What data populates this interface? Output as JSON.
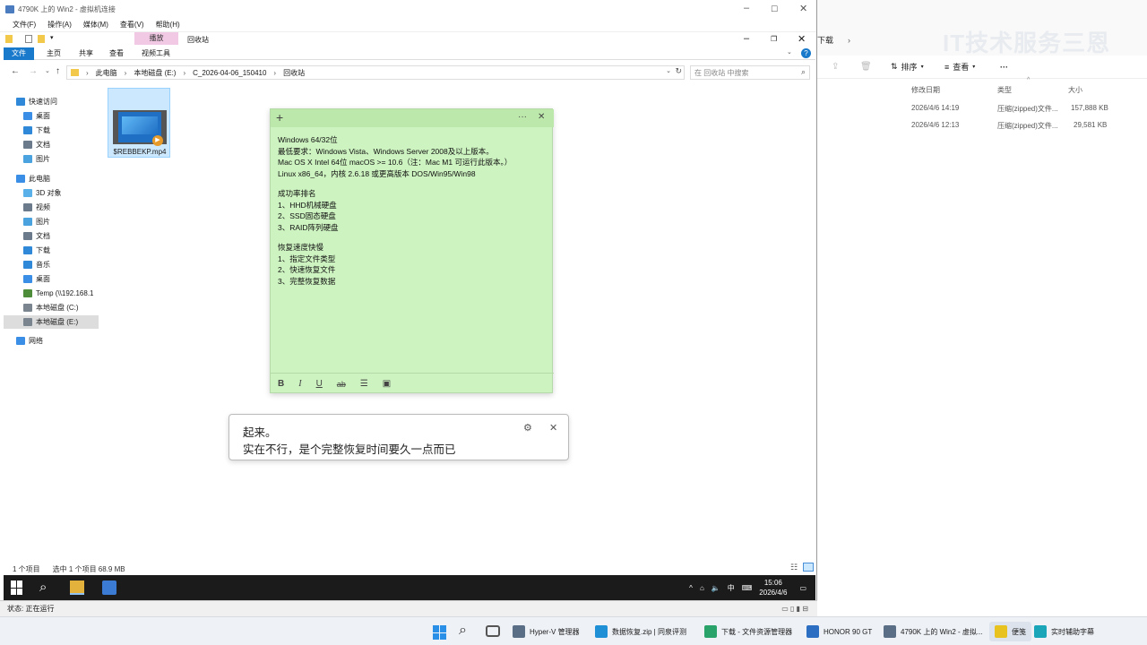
{
  "host": {
    "breadcrumb": "下载",
    "watermark": "IT技术服务三恩",
    "toolbar": {
      "sort": "排序",
      "view": "查看",
      "more": "···"
    },
    "columns": {
      "date": "修改日期",
      "type": "类型",
      "size": "大小"
    },
    "rows": [
      {
        "date": "2026/4/6 14:19",
        "type": "压缩(zipped)文件...",
        "size": "157,888 KB"
      },
      {
        "date": "2026/4/6 12:13",
        "type": "压缩(zipped)文件...",
        "size": "29,581 KB"
      }
    ]
  },
  "vm": {
    "title": "4790K 上的 Win2 - 虚拟机连接",
    "menu": [
      "文件(F)",
      "操作(A)",
      "媒体(M)",
      "查看(V)",
      "帮助(H)"
    ],
    "status": "状态: 正在运行"
  },
  "guest": {
    "ribbon": {
      "context_tab": "播放",
      "window_title": "回收站",
      "tabs": [
        "文件",
        "主页",
        "共享",
        "查看",
        "视频工具"
      ]
    },
    "address": {
      "path": [
        "此电脑",
        "本地磁盘 (E:)",
        "C_2026-04-06_150410",
        "回收站"
      ],
      "search_placeholder": "在 回收站 中搜索"
    },
    "nav": [
      {
        "label": "快速访问",
        "icon": "star-icon",
        "color": "#2f88d8"
      },
      {
        "label": "桌面",
        "icon": "desktop-icon",
        "color": "#3a8ee6"
      },
      {
        "label": "下载",
        "icon": "download-icon",
        "color": "#2f88d8"
      },
      {
        "label": "文档",
        "icon": "document-icon",
        "color": "#6b7b8c"
      },
      {
        "label": "图片",
        "icon": "picture-icon",
        "color": "#4aa3df"
      },
      {
        "label": "此电脑",
        "icon": "pc-icon",
        "color": "#3a8ee6"
      },
      {
        "label": "3D 对象",
        "icon": "cube-icon",
        "color": "#5ab0e8"
      },
      {
        "label": "视频",
        "icon": "video-icon",
        "color": "#6b7b8c"
      },
      {
        "label": "图片",
        "icon": "picture-icon",
        "color": "#4aa3df"
      },
      {
        "label": "文档",
        "icon": "document-icon",
        "color": "#6b7b8c"
      },
      {
        "label": "下载",
        "icon": "download-icon",
        "color": "#2f88d8"
      },
      {
        "label": "音乐",
        "icon": "music-icon",
        "color": "#2f88d8"
      },
      {
        "label": "桌面",
        "icon": "desktop-icon",
        "color": "#3a8ee6"
      },
      {
        "label": "Temp (\\\\192.168.1",
        "icon": "network-drive-icon",
        "color": "#4d8d3a"
      },
      {
        "label": "本地磁盘 (C:)",
        "icon": "drive-icon",
        "color": "#7a8590"
      },
      {
        "label": "本地磁盘 (E:)",
        "icon": "drive-icon",
        "color": "#7a8590"
      },
      {
        "label": "网络",
        "icon": "network-icon",
        "color": "#3a8ee6"
      }
    ],
    "file": {
      "name": "$REBBEKP.mp4"
    },
    "statusbar": {
      "count": "1 个项目",
      "selected": "选中 1 个项目 68.9 MB"
    },
    "tray": {
      "ime": "中",
      "time": "15:06",
      "date": "2026/4/6"
    }
  },
  "sticky": {
    "lines": [
      "Windows 64/32位",
      "最低要求：Windows Vista、Windows Server 2008及以上版本。",
      "Mac OS X Intel 64位 macOS >= 10.6（注：Mac M1 可运行此版本。）",
      "Linux x86_64，内核 2.6.18 或更高版本 DOS/Win95/Win98",
      "",
      "成功率排名",
      "1、HHD机械硬盘",
      "2、SSD固态硬盘",
      "3、RAID阵列硬盘",
      "",
      "恢复速度快慢",
      "1、指定文件类型",
      "2、快速恢复文件",
      "3、完整恢复数据"
    ],
    "toolbar": {
      "bold": "B",
      "italic": "I",
      "underline": "U",
      "strike": "ab"
    }
  },
  "caption": {
    "line1": "起来。",
    "line2": "实在不行，是个完整恢复时间要久一点而已"
  },
  "taskbar": {
    "items": [
      {
        "label": "Hyper-V 管理器",
        "icon": "hyperv-icon",
        "color": "#5a6f86"
      },
      {
        "label": "数据恢复.zip | 同泉评测",
        "icon": "edge-icon",
        "color": "#1f8fd6"
      },
      {
        "label": "下载 - 文件资源管理器",
        "icon": "download-icon",
        "color": "#2aa36b"
      },
      {
        "label": "HONOR 90 GT",
        "icon": "phone-icon",
        "color": "#2c6fc2"
      },
      {
        "label": "4790K 上的 Win2 - 虚拟...",
        "icon": "vm-icon",
        "color": "#5a6f86"
      },
      {
        "label": "便笺",
        "icon": "sticky-notes-icon",
        "color": "#e8c21e"
      },
      {
        "label": "实时辅助字幕",
        "icon": "captions-icon",
        "color": "#1ba5b8"
      }
    ]
  }
}
